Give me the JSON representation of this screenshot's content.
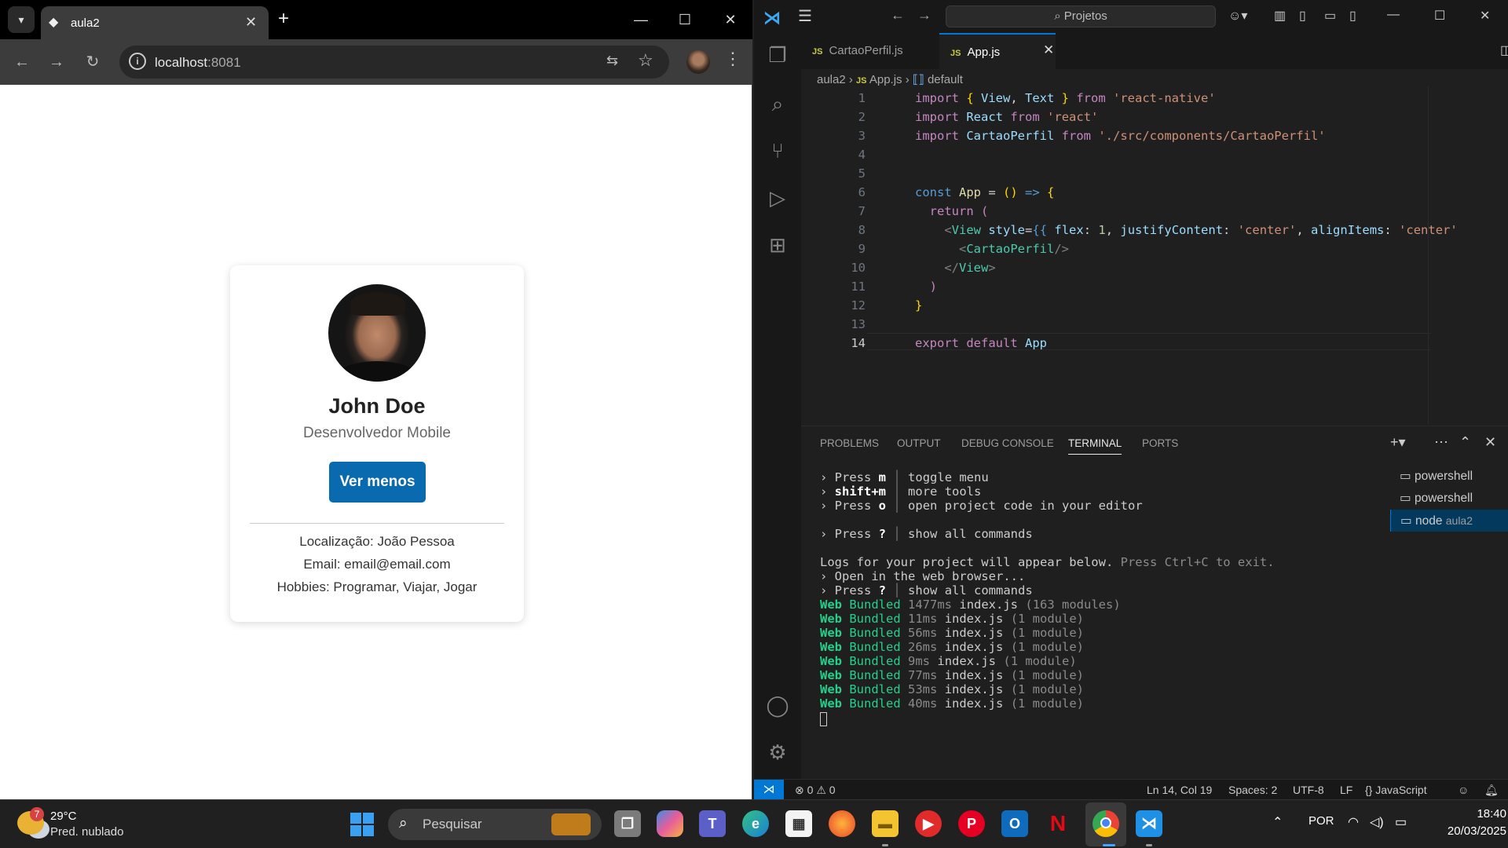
{
  "browser": {
    "tab_title": "aula2",
    "url_host": "localhost",
    "url_port": ":8081",
    "tab_close": "✕",
    "new_tab": "+",
    "window_controls": [
      "—",
      "☐",
      "✕"
    ]
  },
  "profile_card": {
    "name": "John Doe",
    "role": "Desenvolvedor Mobile",
    "toggle_label": "Ver menos",
    "location": "Localização: João Pessoa",
    "email": "Email: email@email.com",
    "hobbies": "Hobbies: Programar, Viajar, Jogar"
  },
  "vscode": {
    "search_placeholder": "Projetos",
    "tabs": [
      {
        "label": "CartaoPerfil.js",
        "icon": "JS"
      },
      {
        "label": "App.js",
        "icon": "JS"
      }
    ],
    "breadcrumb": {
      "folder": "aula2",
      "file": "App.js",
      "symbol": "default",
      "file_icon": "JS"
    },
    "line_numbers": [
      "1",
      "2",
      "3",
      "4",
      "5",
      "6",
      "7",
      "8",
      "9",
      "10",
      "11",
      "12",
      "13",
      "14"
    ],
    "code": {
      "l1": [
        "import",
        " { ",
        "View",
        ", ",
        "Text",
        " } ",
        "from",
        " ",
        "'react-native'"
      ],
      "l2": [
        "import",
        " ",
        "React",
        " ",
        "from",
        " ",
        "'react'"
      ],
      "l3": [
        "import",
        " ",
        "CartaoPerfil",
        " ",
        "from",
        " ",
        "'./src/components/CartaoPerfil'"
      ],
      "l6": [
        "const",
        " ",
        "App",
        " = ",
        "()",
        " ",
        "=>",
        " ",
        "{"
      ],
      "l7": [
        "  ",
        "return",
        " ",
        "("
      ],
      "l8": [
        "    <",
        "View",
        " ",
        "style",
        "=",
        "{{",
        " ",
        "flex",
        ": ",
        "1",
        ", ",
        "justifyContent",
        ": ",
        "'center'",
        ", ",
        "alignItems",
        ": ",
        "'center'"
      ],
      "l9": [
        "      <",
        "CartaoPerfil",
        "/>"
      ],
      "l10": [
        "    </",
        "View",
        ">"
      ],
      "l11": [
        "  ",
        ")"
      ],
      "l12": [
        "}"
      ],
      "l14": [
        "export",
        " ",
        "default",
        " ",
        "App"
      ]
    },
    "panel_tabs": [
      "PROBLEMS",
      "OUTPUT",
      "DEBUG CONSOLE",
      "TERMINAL",
      "PORTS"
    ],
    "terminal": {
      "press_m": {
        "prefix": "› Press ",
        "key": "m",
        "desc": "toggle menu"
      },
      "shift_m": {
        "prefix": "› ",
        "key": "shift+m",
        "desc": "more tools"
      },
      "press_o": {
        "prefix": "› Press ",
        "key": "o",
        "desc": "open project code in your editor"
      },
      "press_q1": {
        "prefix": "› Press ",
        "key": "?",
        "desc": "show all commands"
      },
      "logs_line": "Logs for your project will appear below.",
      "logs_hint": "Press Ctrl+C to exit.",
      "open_web": "› Open in the web browser...",
      "press_q2": {
        "prefix": "› Press ",
        "key": "?",
        "desc": "show all commands"
      },
      "bundles": [
        {
          "platform": "Web",
          "status": "Bundled",
          "time": "1477ms",
          "file": "index.js",
          "mods": "(163 modules)"
        },
        {
          "platform": "Web",
          "status": "Bundled",
          "time": "11ms",
          "file": "index.js",
          "mods": "(1 module)"
        },
        {
          "platform": "Web",
          "status": "Bundled",
          "time": "56ms",
          "file": "index.js",
          "mods": "(1 module)"
        },
        {
          "platform": "Web",
          "status": "Bundled",
          "time": "26ms",
          "file": "index.js",
          "mods": "(1 module)"
        },
        {
          "platform": "Web",
          "status": "Bundled",
          "time": "9ms",
          "file": "index.js",
          "mods": "(1 module)"
        },
        {
          "platform": "Web",
          "status": "Bundled",
          "time": "77ms",
          "file": "index.js",
          "mods": "(1 module)"
        },
        {
          "platform": "Web",
          "status": "Bundled",
          "time": "53ms",
          "file": "index.js",
          "mods": "(1 module)"
        },
        {
          "platform": "Web",
          "status": "Bundled",
          "time": "40ms",
          "file": "index.js",
          "mods": "(1 module)"
        }
      ]
    },
    "terminal_list": [
      {
        "label": "powershell",
        "sub": ""
      },
      {
        "label": "powershell",
        "sub": ""
      },
      {
        "label": "node",
        "sub": "aula2"
      }
    ],
    "status": {
      "errors": "0",
      "warnings": "0",
      "position": "Ln 14, Col 19",
      "spaces": "Spaces: 2",
      "encoding": "UTF-8",
      "eol": "LF",
      "language": "JavaScript"
    }
  },
  "taskbar": {
    "temperature": "29°C",
    "condition": "Pred. nublado",
    "weather_badge": "7",
    "search_label": "Pesquisar",
    "language": "POR",
    "time": "18:40",
    "date": "20/03/2025"
  },
  "colors": {
    "accent_blue": "#0078d4",
    "button_blue": "#0a6ab0",
    "terminal_green": "#23d18b"
  }
}
